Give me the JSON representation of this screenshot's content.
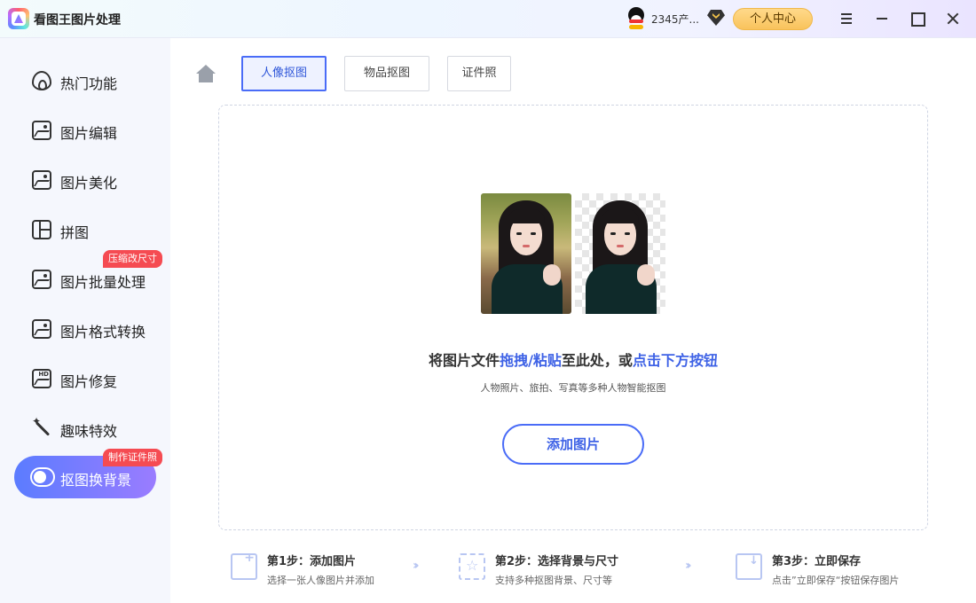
{
  "app": {
    "title": "看图王图片处理"
  },
  "header": {
    "username": "2345产...",
    "personal_center": "个人中心"
  },
  "sidebar": {
    "items": [
      {
        "label": "热门功能",
        "icon": "flame-icon"
      },
      {
        "label": "图片编辑",
        "icon": "image-edit-icon"
      },
      {
        "label": "图片美化",
        "icon": "beautify-icon"
      },
      {
        "label": "拼图",
        "icon": "collage-icon"
      },
      {
        "label": "图片批量处理",
        "icon": "batch-icon",
        "badge": "压缩改尺寸"
      },
      {
        "label": "图片格式转换",
        "icon": "convert-icon"
      },
      {
        "label": "图片修复",
        "icon": "hd-repair-icon"
      },
      {
        "label": "趣味特效",
        "icon": "magic-wand-icon"
      },
      {
        "label": "抠图换背景",
        "icon": "toggle-icon",
        "badge": "制作证件照",
        "active": true
      }
    ]
  },
  "tabs": [
    {
      "label": "人像抠图",
      "active": true
    },
    {
      "label": "物品抠图"
    },
    {
      "label": "证件照"
    }
  ],
  "drop_zone": {
    "text_part1": "将图片文件",
    "text_highlight1": "拖拽/粘贴",
    "text_part2": "至此处，或",
    "text_highlight2": "点击下方按钮",
    "subtext": "人物照片、旅拍、写真等多种人物智能抠图",
    "add_button": "添加图片"
  },
  "steps": [
    {
      "title": "第1步：添加图片",
      "desc": "选择一张人像图片并添加"
    },
    {
      "title": "第2步：选择背景与尺寸",
      "desc": "支持多种抠图背景、尺寸等"
    },
    {
      "title": "第3步：立即保存",
      "desc": "点击”立即保存“按钮保存图片"
    }
  ]
}
